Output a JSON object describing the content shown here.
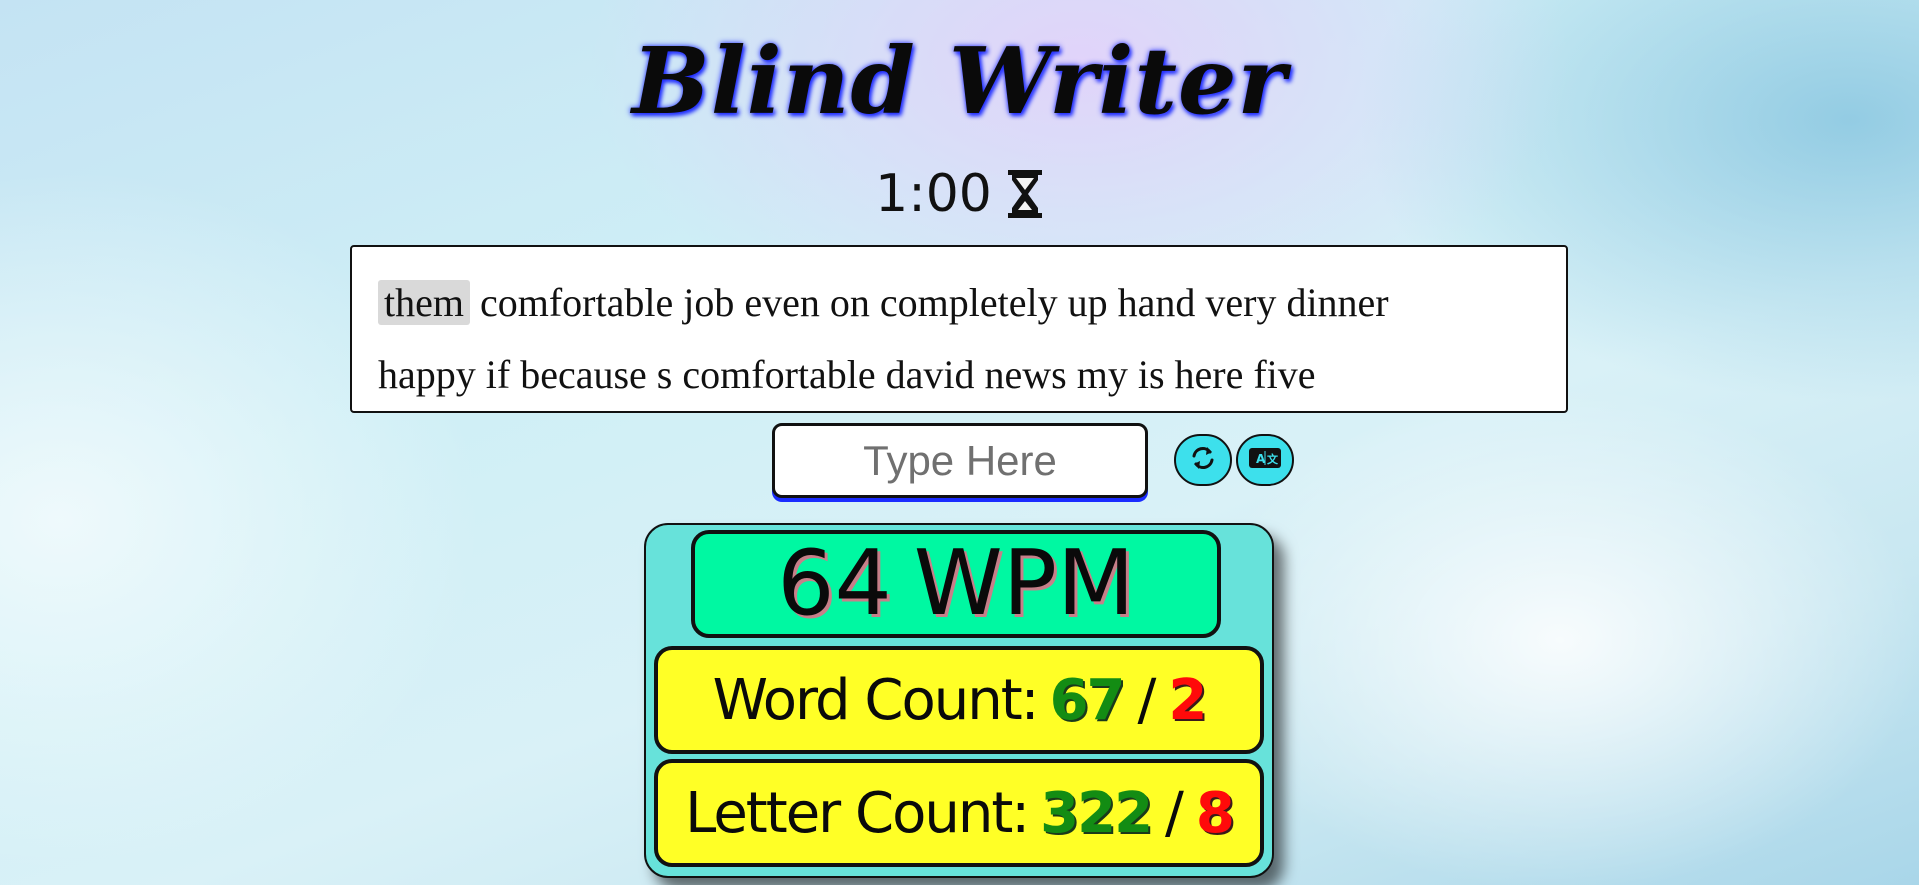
{
  "app": {
    "title": "Blind Writer"
  },
  "timer": {
    "value": "1:00",
    "icon": "hourglass-icon"
  },
  "passage": {
    "current_word": "them",
    "line1": [
      "comfortable",
      "job",
      "even",
      "on",
      "completely",
      "up",
      "hand",
      "very",
      "dinner"
    ],
    "line2": [
      "happy",
      "if",
      "because",
      "s",
      "comfortable",
      "david",
      "news",
      "my",
      "is",
      "here",
      "five"
    ]
  },
  "input": {
    "placeholder": "Type Here",
    "value": ""
  },
  "buttons": {
    "restart_icon": "repeat-icon",
    "language_icon": "language-icon",
    "accent_color": "#3de0ec"
  },
  "stats": {
    "wpm_value": "64",
    "wpm_unit": "WPM",
    "word_count_label": "Word Count:",
    "word_correct": "67",
    "word_separator": "/",
    "word_wrong": "2",
    "letter_count_label": "Letter Count:",
    "letter_correct": "322",
    "letter_separator": "/",
    "letter_wrong": "8",
    "colors": {
      "panel": "#67e2da",
      "wpm_bg": "#00f8a2",
      "count_bg": "#ffff26",
      "correct": "#138c13",
      "wrong": "#ff0a0a"
    }
  }
}
